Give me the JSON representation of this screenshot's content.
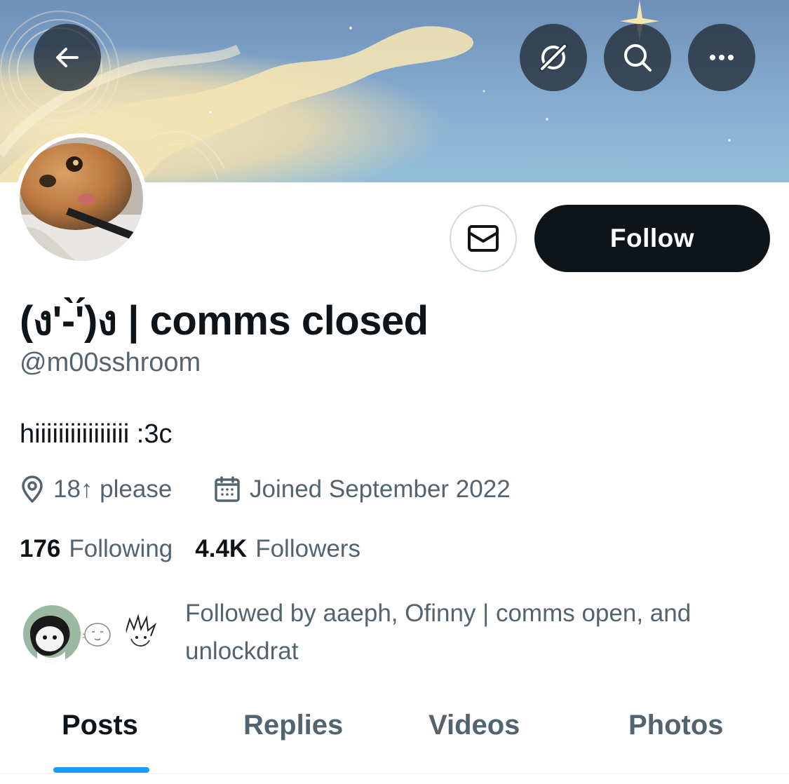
{
  "header": {
    "back_icon": "arrow-left-icon",
    "actions": [
      {
        "name": "grok-icon"
      },
      {
        "name": "search-icon"
      },
      {
        "name": "more-icon"
      }
    ]
  },
  "profile": {
    "display_name": "(ง'-̀'́)ง | comms closed",
    "handle": "@m00sshroom",
    "bio": "hiiiiiiiiiiiiiiii :3c",
    "location": "18↑ please",
    "joined": "Joined September 2022",
    "following_count": "176",
    "following_label": "Following",
    "followers_count": "4.4K",
    "followers_label": "Followers",
    "followed_by": "Followed by aaeph, Ofinny | comms open, and unlockdrat"
  },
  "buttons": {
    "follow_label": "Follow",
    "message_icon": "envelope-icon"
  },
  "tabs": [
    {
      "label": "Posts",
      "active": true
    },
    {
      "label": "Replies",
      "active": false
    },
    {
      "label": "Videos",
      "active": false
    },
    {
      "label": "Photos",
      "active": false
    }
  ],
  "colors": {
    "accent": "#1d9bf0",
    "text_primary": "#0f1419",
    "text_secondary": "#536471",
    "follow_button_bg": "#0f1419"
  }
}
